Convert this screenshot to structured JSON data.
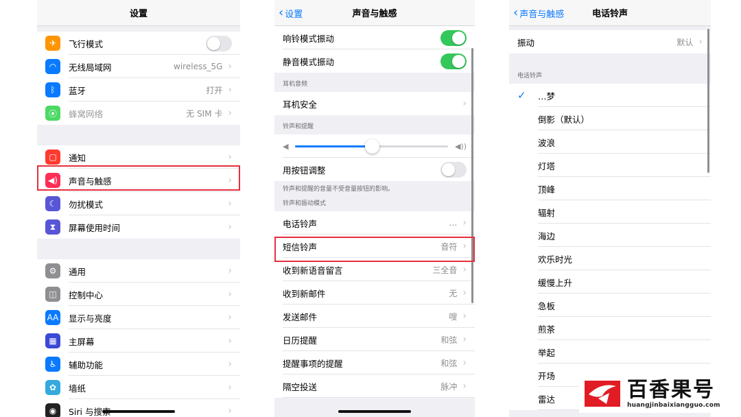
{
  "screen1": {
    "title": "设置",
    "group1": [
      {
        "label": "飞行模式",
        "icon": "airplane-icon",
        "color": "#ff9500",
        "glyph": "✈",
        "toggle": "off"
      },
      {
        "label": "无线局域网",
        "icon": "wifi-icon",
        "color": "#0a7aff",
        "glyph": "◠",
        "value": "wireless_5G"
      },
      {
        "label": "蓝牙",
        "icon": "bluetooth-icon",
        "color": "#0a7aff",
        "glyph": "ᛒ",
        "value": "打开"
      },
      {
        "label": "蜂窝网络",
        "icon": "cellular-icon",
        "color": "#4cd964",
        "glyph": "⦿",
        "value": "无 SIM 卡",
        "dimmed": true
      }
    ],
    "group2": [
      {
        "label": "通知",
        "icon": "notifications-icon",
        "color": "#ff3b30",
        "glyph": "▢"
      },
      {
        "label": "声音与触感",
        "icon": "sound-icon",
        "color": "#ff2d55",
        "glyph": "◀)"
      },
      {
        "label": "勿扰模式",
        "icon": "moon-icon",
        "color": "#5856d6",
        "glyph": "☾"
      },
      {
        "label": "屏幕使用时间",
        "icon": "hourglass-icon",
        "color": "#5856d6",
        "glyph": "⧗"
      }
    ],
    "group3": [
      {
        "label": "通用",
        "icon": "gear-icon",
        "color": "#8e8e93",
        "glyph": "⚙"
      },
      {
        "label": "控制中心",
        "icon": "control-center-icon",
        "color": "#8e8e93",
        "glyph": "◫"
      },
      {
        "label": "显示与亮度",
        "icon": "display-icon",
        "color": "#0a7aff",
        "glyph": "AA"
      },
      {
        "label": "主屏幕",
        "icon": "home-screen-icon",
        "color": "#3a49d6",
        "glyph": "▦"
      },
      {
        "label": "辅助功能",
        "icon": "accessibility-icon",
        "color": "#0a7aff",
        "glyph": "♿"
      },
      {
        "label": "墙纸",
        "icon": "wallpaper-icon",
        "color": "#34aadc",
        "glyph": "✿"
      },
      {
        "label": "Siri 与搜索",
        "icon": "siri-icon",
        "color": "#222222",
        "glyph": "◉"
      }
    ]
  },
  "screen2": {
    "back": "设置",
    "title": "声音与触感",
    "vibrate": [
      {
        "label": "响铃模式振动",
        "toggle": "on"
      },
      {
        "label": "静音模式振动",
        "toggle": "on"
      }
    ],
    "headphone_header": "耳机音频",
    "headphone_row": "耳机安全",
    "ringer_header": "铃声和提醒",
    "ringer_volume": 0.5,
    "button_adjust": "用按钮调整",
    "ringer_footer": "铃声和提醒的音量不受音量按钮的影响。",
    "patterns_header": "铃声和振动模式",
    "patterns": [
      {
        "label": "电话铃声",
        "value": "…"
      },
      {
        "label": "短信铃声",
        "value": "音符"
      },
      {
        "label": "收到新语音留言",
        "value": "三全音"
      },
      {
        "label": "收到新邮件",
        "value": "无"
      },
      {
        "label": "发送邮件",
        "value": "嗖"
      },
      {
        "label": "日历提醒",
        "value": "和弦"
      },
      {
        "label": "提醒事项的提醒",
        "value": "和弦"
      },
      {
        "label": "隔空投送",
        "value": "脉冲"
      }
    ]
  },
  "screen3": {
    "back": "声音与触感",
    "title": "电话铃声",
    "vibration_label": "振动",
    "vibration_value": "默认",
    "ringtones_header": "电话铃声",
    "selected": "…梦",
    "ringtones": [
      "倒影（默认）",
      "波浪",
      "灯塔",
      "顶峰",
      "辐射",
      "海边",
      "欢乐时光",
      "缓慢上升",
      "急板",
      "煎茶",
      "举起",
      "开场",
      "雷达"
    ]
  },
  "watermark": {
    "brand": "百香果号",
    "url": "huangjinbaixiangguo.com"
  },
  "colors": {
    "accent": "#0a7aff",
    "toggle_on": "#34c759",
    "highlight": "#e5303c"
  }
}
